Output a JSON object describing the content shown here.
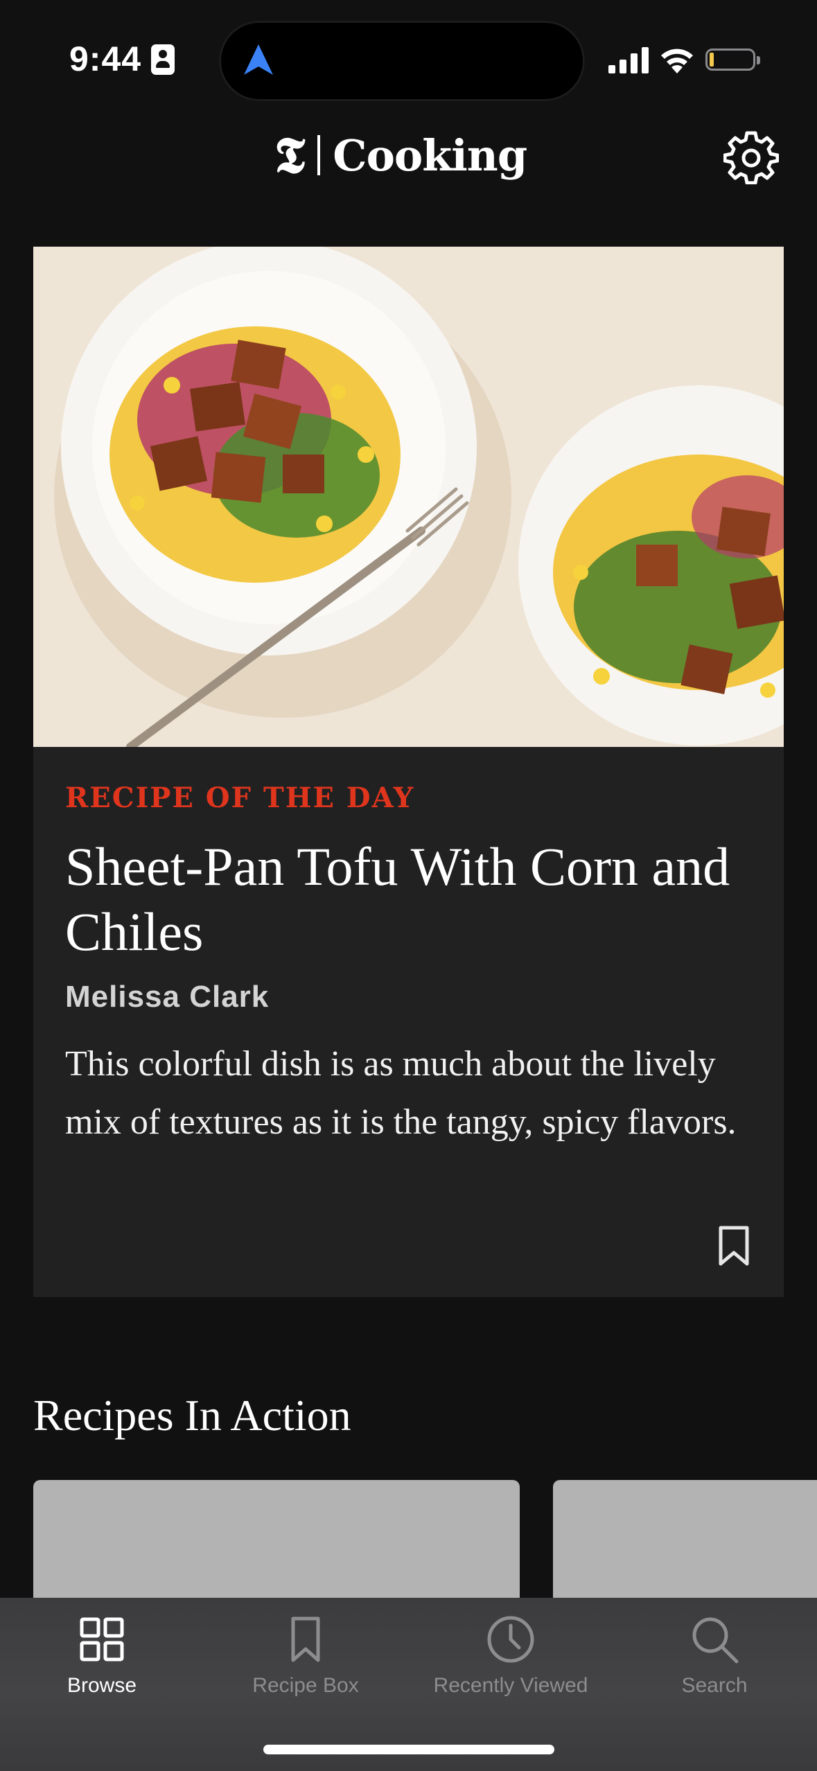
{
  "status_bar": {
    "time": "9:44"
  },
  "header": {
    "brand_mark": "𝕿",
    "brand_name": "Cooking",
    "settings_icon": "gear-icon"
  },
  "hero": {
    "kicker": "RECIPE OF THE DAY",
    "title": "Sheet-Pan Tofu With Corn and Chiles",
    "author": "Melissa Clark",
    "description": "This colorful dish is as much about the lively mix of textures as it is the tangy, spicy flavors.",
    "save_icon": "bookmark-icon"
  },
  "section": {
    "title": "Recipes In Action"
  },
  "tab_bar": {
    "tabs": [
      {
        "label": "Browse",
        "icon": "grid-icon",
        "active": true
      },
      {
        "label": "Recipe Box",
        "icon": "bookmark-icon",
        "active": false
      },
      {
        "label": "Recently Viewed",
        "icon": "clock-icon",
        "active": false
      },
      {
        "label": "Search",
        "icon": "search-icon",
        "active": false
      }
    ]
  },
  "colors": {
    "background": "#111112",
    "card": "#212122",
    "kicker": "#e0351d",
    "tab_inactive": "#8d8d90",
    "location_arrow": "#3b82f6",
    "battery_level": "#f2c94c"
  }
}
